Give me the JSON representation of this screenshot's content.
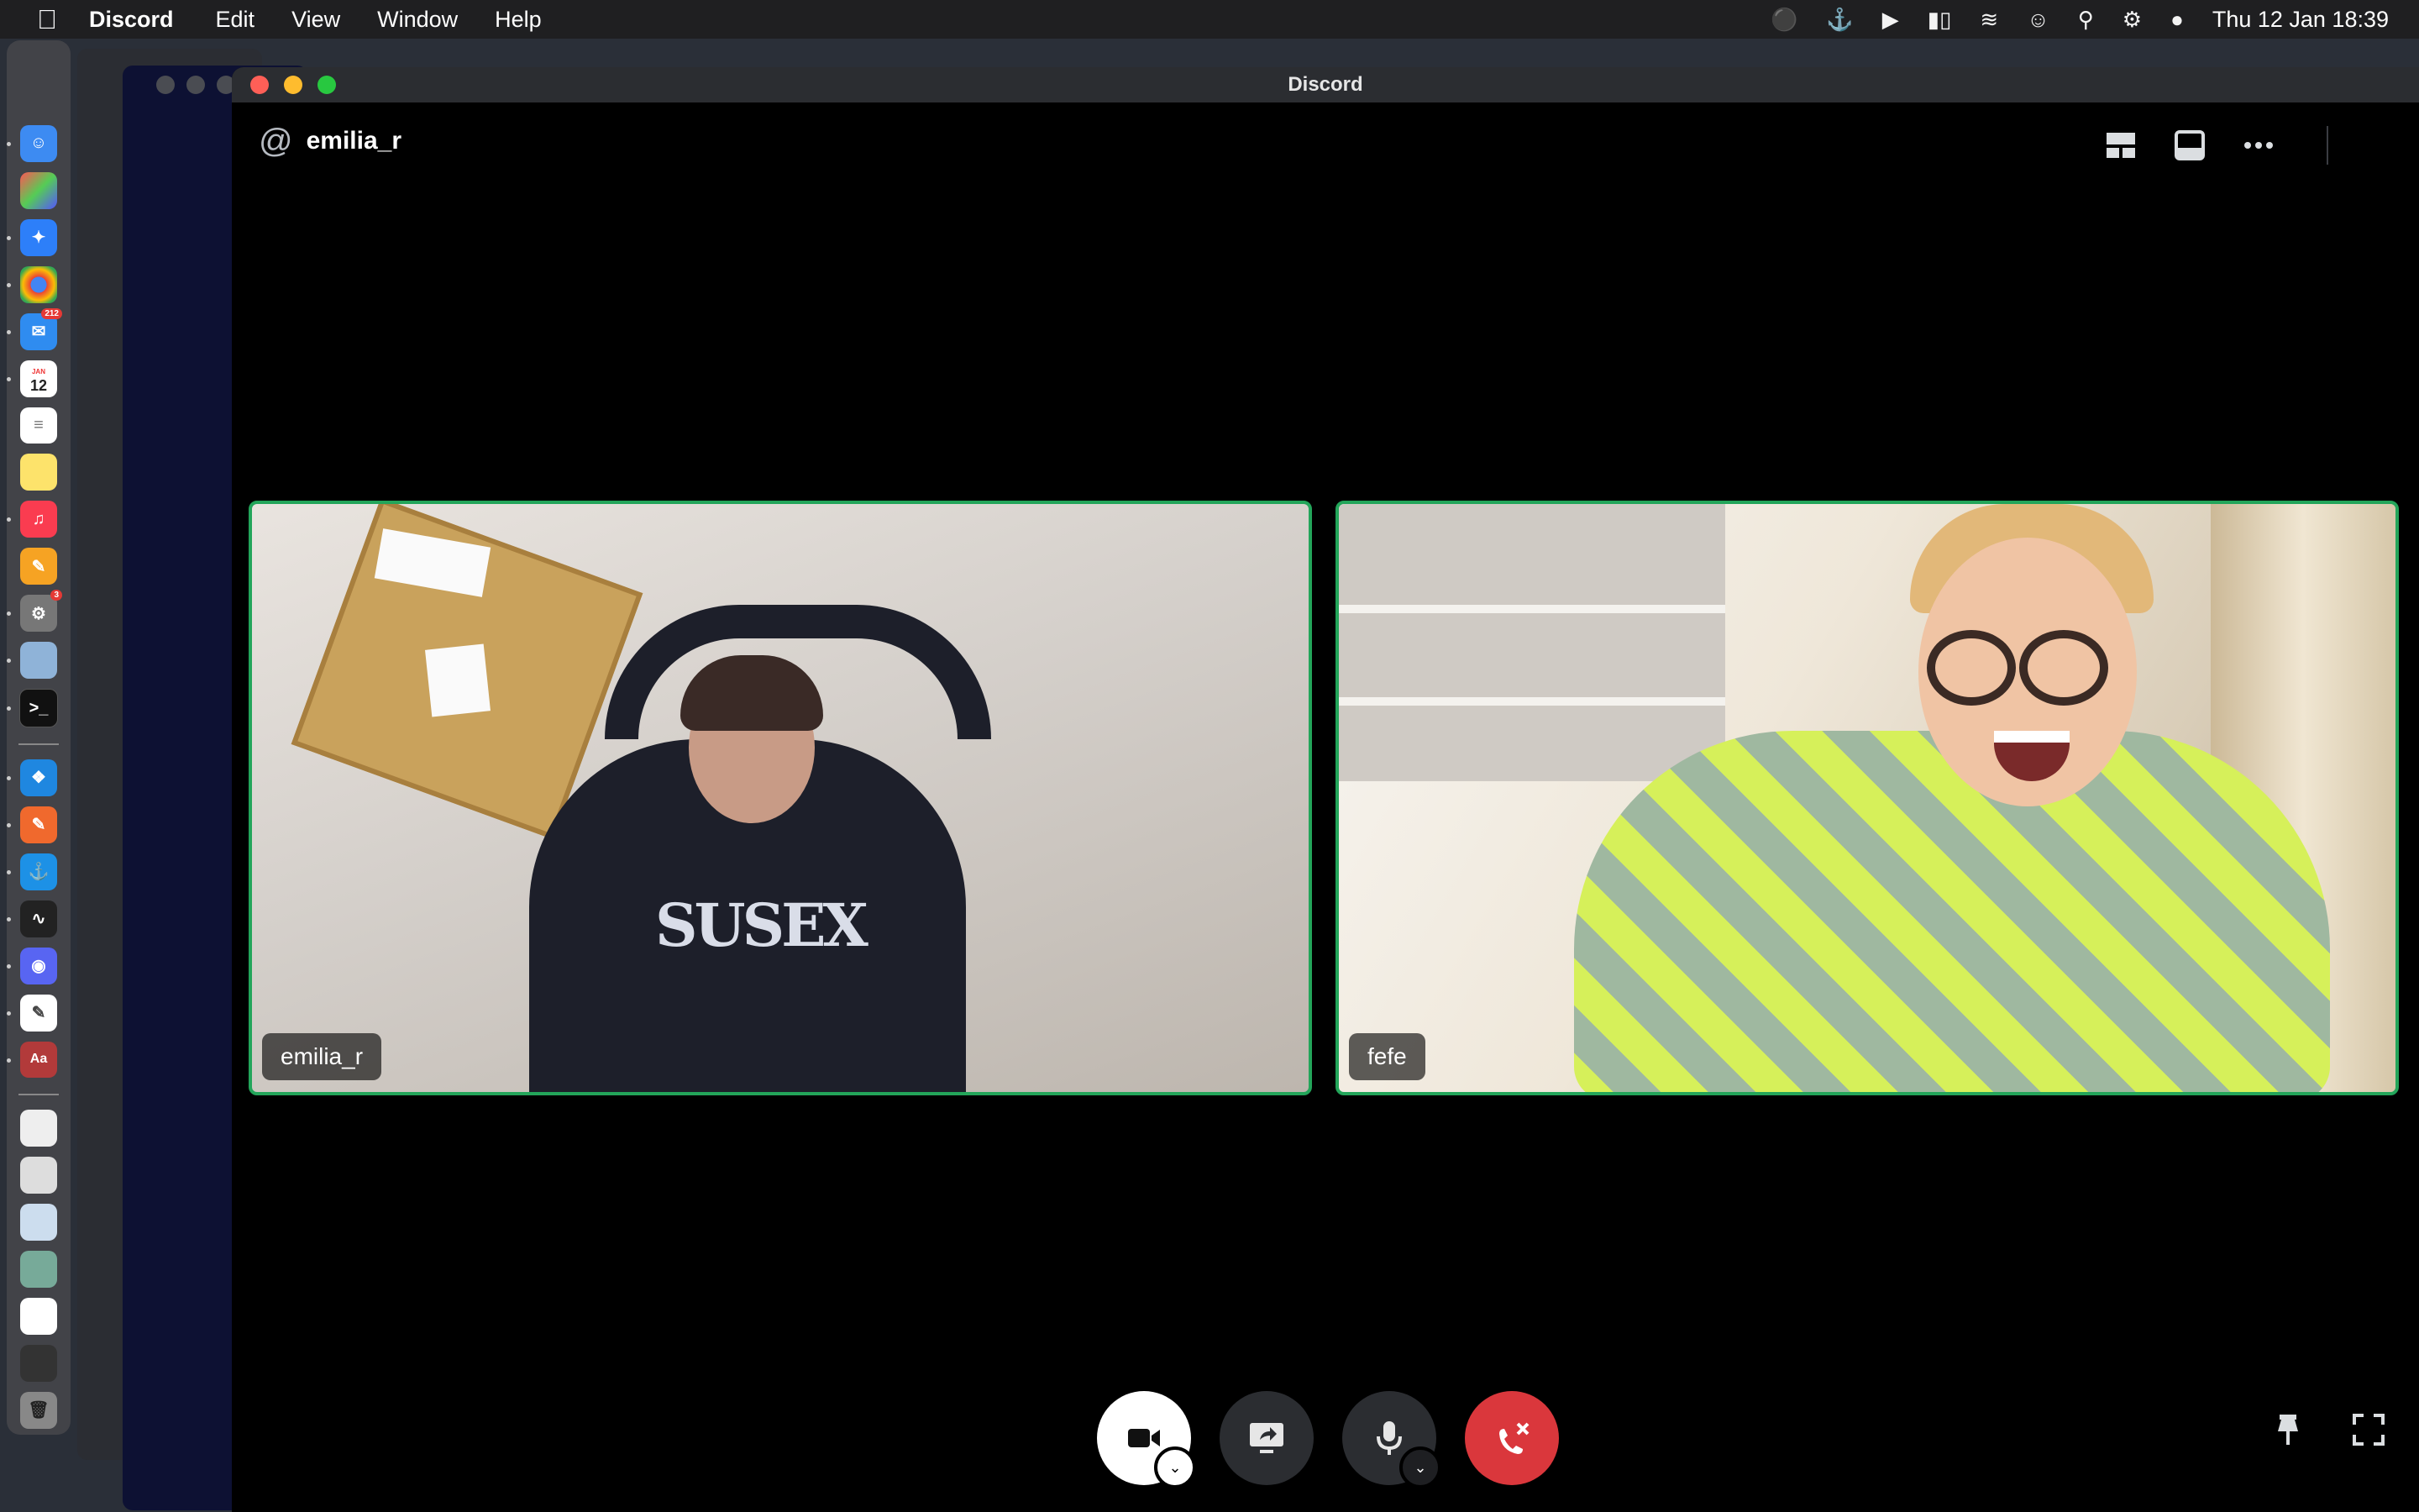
{
  "menubar": {
    "app_name": "Discord",
    "items": [
      "Edit",
      "View",
      "Window",
      "Help"
    ],
    "datetime": "Thu 12 Jan  18:39"
  },
  "dock": {
    "mail_badge": "212",
    "settings_badge": "3",
    "calendar_day": "12",
    "calendar_month": "JAN"
  },
  "window": {
    "title": "Discord"
  },
  "call": {
    "channel_name": "emilia_r",
    "participants": [
      {
        "name": "emilia_r",
        "speaking_border": "#23a55a"
      },
      {
        "name": "fefe",
        "speaking_border": "#23a55a"
      }
    ]
  },
  "hoodie_print": "SUSEX",
  "colors": {
    "end_call": "#da373c",
    "speaking": "#23a55a",
    "titlebar": "#2b2d31"
  }
}
